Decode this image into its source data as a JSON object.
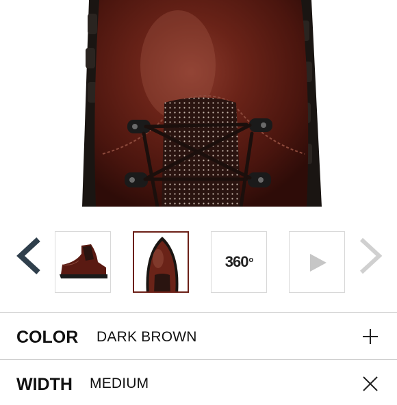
{
  "product_images": {
    "hero_alt": "Dark brown leather boot toe with black laces",
    "thumbnails": [
      {
        "kind": "image",
        "name": "boot-side-view",
        "selected": false
      },
      {
        "kind": "image",
        "name": "boot-top-view",
        "selected": true
      },
      {
        "kind": "360",
        "label": "360",
        "degree": "o",
        "selected": false
      },
      {
        "kind": "video",
        "icon": "play-icon",
        "selected": false
      }
    ],
    "prev_icon": "chevron-left-icon",
    "next_icon": "chevron-right-icon"
  },
  "options": {
    "color": {
      "label": "COLOR",
      "value": "DARK BROWN",
      "icon": "plus-icon"
    },
    "width": {
      "label": "WIDTH",
      "value": "MEDIUM",
      "icon": "close-icon"
    }
  },
  "colors": {
    "accent": "#6b1f16",
    "leather": "#5a1a12",
    "chevron_active": "#2f3f4c",
    "chevron_inactive": "#d0d0d0"
  }
}
